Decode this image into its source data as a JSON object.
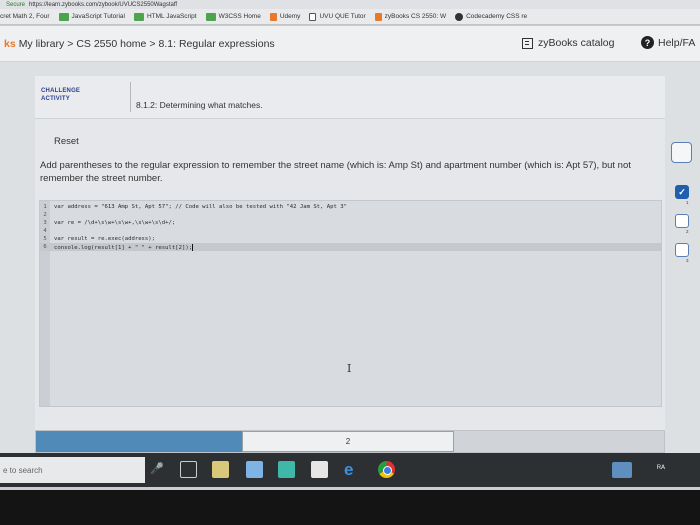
{
  "browser": {
    "url_secure": "Secure",
    "url_text": "https://learn.zybooks.com/zybook/UVUCS2550Wagstaff",
    "bookmarks": [
      {
        "label": "cret Math 2, Four",
        "icon_color": "#e8e9eb"
      },
      {
        "label": "JavaScript Tutorial",
        "icon_color": "#4ea34e"
      },
      {
        "label": "HTML JavaScript",
        "icon_color": "#4ea34e"
      },
      {
        "label": "W3CSS Home",
        "icon_color": "#4ea34e"
      },
      {
        "label": "Udemy",
        "icon_color": "#e8792b"
      },
      {
        "label": "UVU QUE Tutor",
        "icon_color": "#ffffff"
      },
      {
        "label": "zyBooks CS 2550: W",
        "icon_color": "#e8792b"
      },
      {
        "label": "Codecademy CSS re",
        "icon_color": "#333333"
      }
    ]
  },
  "header": {
    "logo_text": "ks",
    "breadcrumb": [
      "My library",
      "CS 2550 home",
      "8.1: Regular expressions"
    ],
    "catalog_label": "zyBooks catalog",
    "help_label": "Help/FA"
  },
  "activity": {
    "badge_line1": "CHALLENGE",
    "badge_line2": "ACTIVITY",
    "title": "8.1.2: Determining what matches.",
    "reset_label": "Reset",
    "instructions": "Add parentheses to the regular expression to remember the street name (which is: Amp St) and apartment number (which is: Apt 57), but not remember the street number.",
    "code_lines": [
      {
        "num": "1",
        "text": "var address = \"613 Amp St, Apt 57\"; // Code will also be tested with \"42 Jam St, Apt 3\""
      },
      {
        "num": "2",
        "text": ""
      },
      {
        "num": "3",
        "text": "var re = /\\d+\\s\\w+\\s\\w+,\\s\\w+\\s\\d+/;"
      },
      {
        "num": "4",
        "text": ""
      },
      {
        "num": "5",
        "text": "var result = re.exec(address);"
      },
      {
        "num": "6",
        "text": "console.log(result[1] + \" \" + result[2]);"
      }
    ],
    "progress_current_label": "2",
    "levels": [
      {
        "num": "1",
        "state": "checked"
      },
      {
        "num": "2",
        "state": "empty"
      },
      {
        "num": "3",
        "state": "empty"
      }
    ]
  },
  "taskbar": {
    "search_placeholder": "e to search",
    "tray_label": "ᴿᴬ"
  },
  "colors": {
    "accent_blue": "#1f5fae",
    "progress_blue": "#4f8ab8",
    "zy_orange": "#e8792b"
  }
}
